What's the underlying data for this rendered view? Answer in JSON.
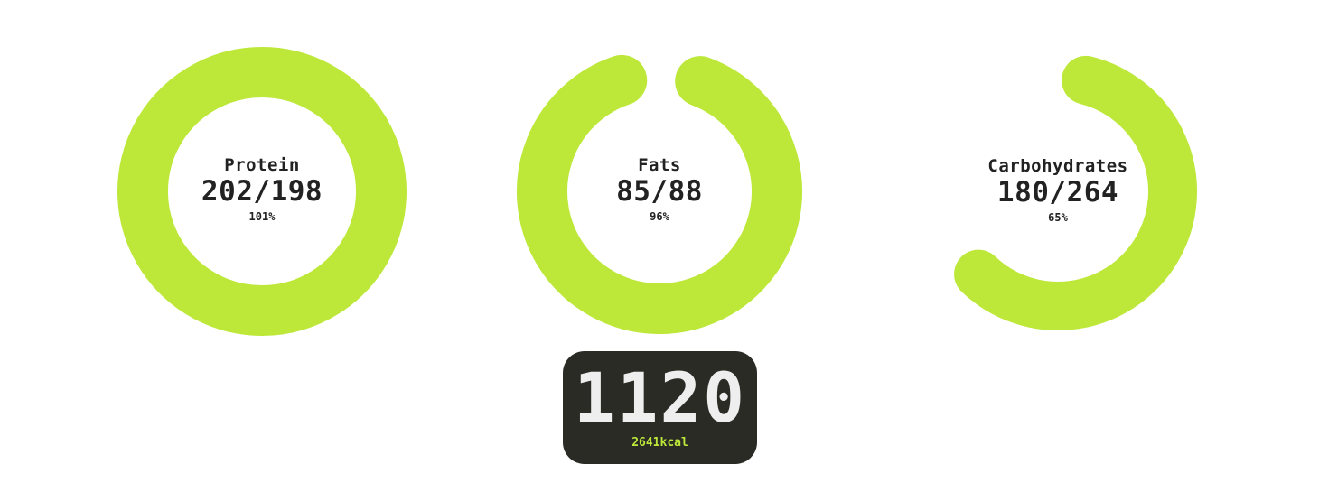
{
  "colors": {
    "ring": "#bde83a",
    "text": "#222222",
    "card_bg": "#2a2b25",
    "card_text": "#eeeeee",
    "goal_text": "#bde83a"
  },
  "macros": [
    {
      "name": "Protein",
      "value_text": "202/198",
      "percent_text": "101%",
      "percent": 101
    },
    {
      "name": "Fats",
      "value_text": "85/88",
      "percent_text": "96%",
      "percent": 96
    },
    {
      "name": "Carbohydrates",
      "value_text": "180/264",
      "percent_text": "65%",
      "percent": 65
    }
  ],
  "calories": {
    "remaining": "1120",
    "goal": "2641kcal"
  }
}
